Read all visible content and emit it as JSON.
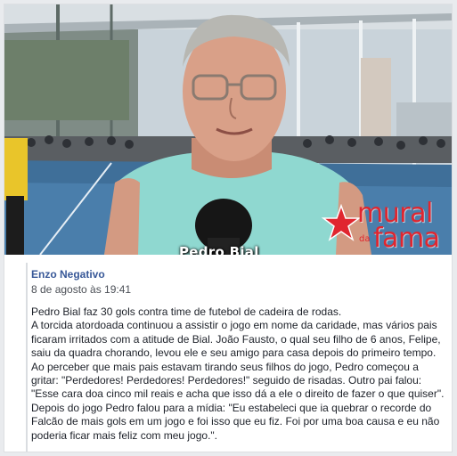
{
  "video": {
    "caption": "Pedro Bial",
    "brand": {
      "word1": "mural",
      "word2": "da",
      "word3": "fama",
      "color": "#e0262f"
    }
  },
  "post": {
    "author": "Enzo Negativo",
    "timestamp": "8 de agosto às 19:41",
    "paragraphs": [
      "Pedro Bial faz 30 gols contra time de futebol de cadeira de rodas.",
      "A torcida atordoada continuou a assistir o jogo em nome da caridade, mas vários pais ficaram irritados com a atitude de Bial. João Fausto, o qual seu filho de 6 anos, Felipe, saiu da quadra chorando, levou ele e seu amigo para casa depois do primeiro tempo.",
      "Ao perceber que mais pais estavam tirando seus filhos do jogo, Pedro começou a gritar: \"Perdedores! Perdedores! Perdedores!\" seguido de risadas. Outro pai falou: \"Esse cara doa cinco mil reais e acha que isso dá a ele o direito de fazer o que quiser\".",
      "Depois do jogo Pedro falou para a mídia: \"Eu estabeleci que ia quebrar o recorde do Falcão de mais gols em um jogo e foi isso que eu fiz. Foi por uma boa causa e eu não poderia ficar mais feliz com meu jogo.\"."
    ]
  },
  "colors": {
    "link": "#385898",
    "text": "#1d2129",
    "meta": "#4b4f56",
    "shirt": "#8fd8d0"
  }
}
